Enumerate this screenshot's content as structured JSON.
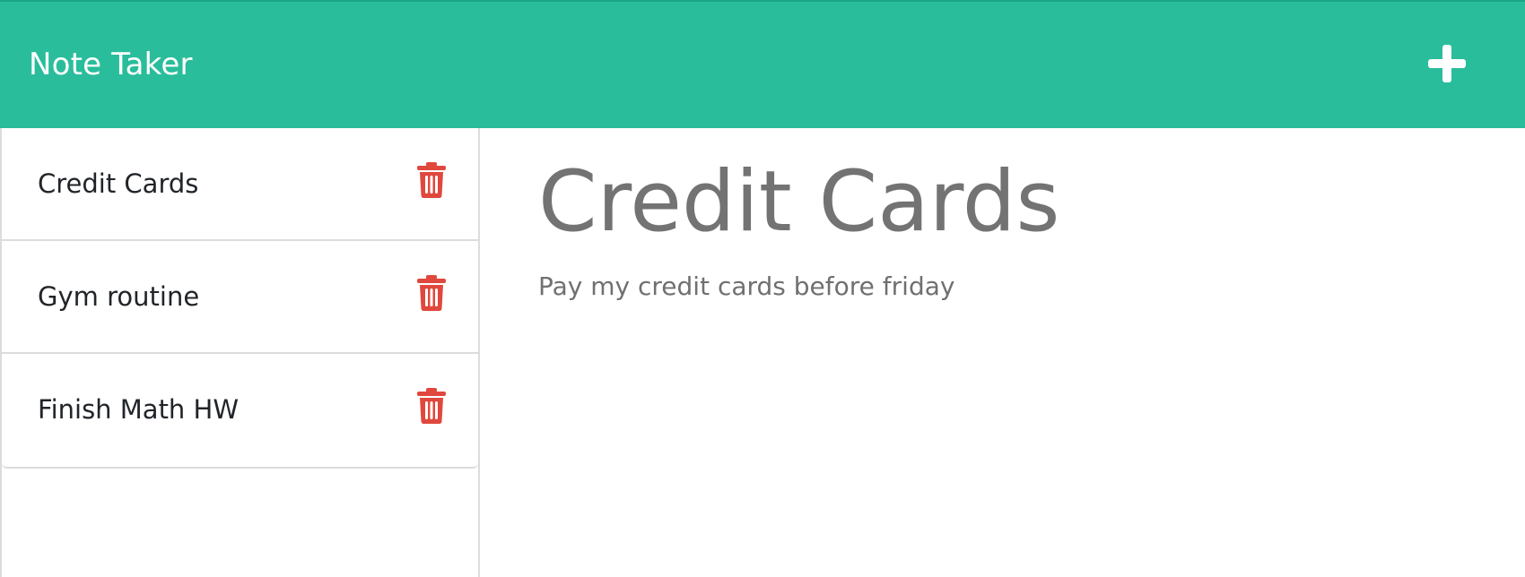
{
  "app": {
    "title": "Note Taker",
    "accent_color": "#2abd9b",
    "delete_color": "#e0483d"
  },
  "header": {
    "brand": "Note Taker",
    "add_icon": "plus-icon"
  },
  "sidebar": {
    "notes": [
      {
        "title": "Credit Cards",
        "delete_icon": "trash-icon"
      },
      {
        "title": "Gym routine",
        "delete_icon": "trash-icon"
      },
      {
        "title": "Finish Math HW",
        "delete_icon": "trash-icon"
      }
    ]
  },
  "main": {
    "active_note": {
      "title": "Credit Cards",
      "text": "Pay my credit cards before friday"
    }
  }
}
